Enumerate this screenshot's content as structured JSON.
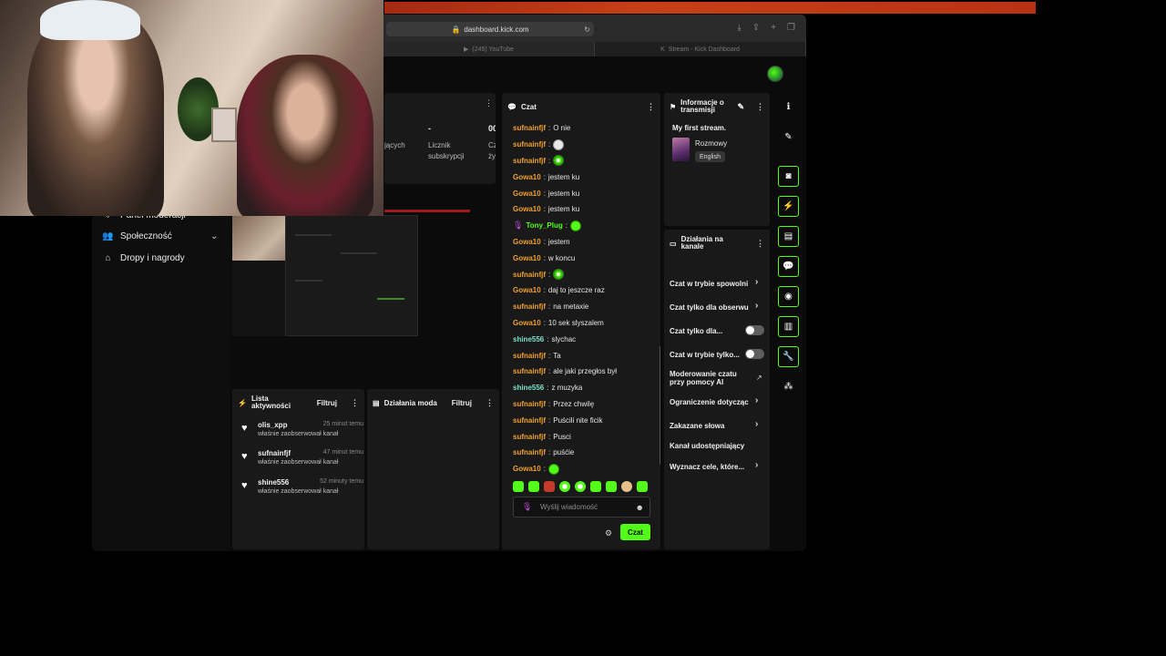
{
  "browser": {
    "url": "dashboard.kick.com",
    "tabs": [
      {
        "label": "(245) YouTube"
      },
      {
        "label": "Stream - Kick Dashboard"
      }
    ]
  },
  "sidebar": {
    "items": [
      {
        "label": "Panel moderacji",
        "icon": "shield-icon"
      },
      {
        "label": "Społeczność",
        "icon": "users-icon"
      },
      {
        "label": "Dropy i nagrody",
        "icon": "gift-icon"
      }
    ]
  },
  "stats": {
    "subs_value": "-",
    "subs_label_line1": "Licznik",
    "subs_label_line2": "subskrypcji",
    "time_value": "00:",
    "time_label_line1": "Cza",
    "time_label_line2": "żyw",
    "left_label": "jących"
  },
  "activity": {
    "title_line1": "Lista",
    "title_line2": "aktywności",
    "filter_label": "Filtruj",
    "items": [
      {
        "name": "olis_xpp",
        "time": "25 minut temu",
        "desc": "właśnie zaobserwował kanał"
      },
      {
        "name": "sufnainfjf",
        "time": "47 minut temu",
        "desc": "właśnie zaobserwował kanał"
      },
      {
        "name": "shine556",
        "time": "52 minuty temu",
        "desc": "właśnie zaobserwował kanał"
      }
    ]
  },
  "mod_actions": {
    "title": "Działania moda",
    "filter_label": "Filtruj"
  },
  "chat": {
    "title": "Czat",
    "messages": [
      {
        "user": "sufnainfjf",
        "color": "#f0a030",
        "text": "O nie"
      },
      {
        "user": "sufnainfjf",
        "color": "#f0a030",
        "text": "",
        "emote": "skull"
      },
      {
        "user": "sufnainfjf",
        "color": "#f0a030",
        "text": "",
        "emote": "gear"
      },
      {
        "user": "Gowa10",
        "color": "#f0a030",
        "text": "jestem ku"
      },
      {
        "user": "Gowa10",
        "color": "#f0a030",
        "text": "jestem ku"
      },
      {
        "user": "Gowa10",
        "color": "#f0a030",
        "text": "jestem ku"
      },
      {
        "user": "Tony_Plug",
        "color": "#53fc18",
        "text": "",
        "emote": "green",
        "mic": true
      },
      {
        "user": "Gowa10",
        "color": "#f0a030",
        "text": "jestem"
      },
      {
        "user": "Gowa10",
        "color": "#f0a030",
        "text": "w koncu"
      },
      {
        "user": "sufnainfjf",
        "color": "#f0a030",
        "text": "",
        "emote": "gear"
      },
      {
        "user": "Gowa10",
        "color": "#f0a030",
        "text": "daj to jeszcze raz"
      },
      {
        "user": "sufnainfjf",
        "color": "#f0a030",
        "text": "na metaxie"
      },
      {
        "user": "Gowa10",
        "color": "#f0a030",
        "text": "10 sek slyszalem"
      },
      {
        "user": "shine556",
        "color": "#7ee0c8",
        "text": "slychac"
      },
      {
        "user": "sufnainfjf",
        "color": "#f0a030",
        "text": "Ta"
      },
      {
        "user": "sufnainfjf",
        "color": "#f0a030",
        "text": "ale jaki przegłos był"
      },
      {
        "user": "shine556",
        "color": "#7ee0c8",
        "text": "z muzyka"
      },
      {
        "user": "sufnainfjf",
        "color": "#f0a030",
        "text": "Przez chwilę"
      },
      {
        "user": "sufnainfjf",
        "color": "#f0a030",
        "text": "Puścili nite ficik"
      },
      {
        "user": "sufnainfjf",
        "color": "#f0a030",
        "text": "Pusci"
      },
      {
        "user": "sufnainfjf",
        "color": "#f0a030",
        "text": "puśćie"
      },
      {
        "user": "Gowa10",
        "color": "#f0a030",
        "text": "",
        "emote": "green"
      }
    ],
    "input_placeholder": "Wyślij wiadomość",
    "send_label": "Czat"
  },
  "stream_info": {
    "title_line1": "Informacje o",
    "title_line2": "transmisji",
    "stream_title": "My first stream.",
    "category": "Rozmowy",
    "language": "English"
  },
  "channel_actions": {
    "title_line1": "Działania na",
    "title_line2": "kanale",
    "items": [
      {
        "label": "Czat w trybie spowolni",
        "control": "arrow"
      },
      {
        "label": "Czat tylko dla obserwu",
        "control": "arrow"
      },
      {
        "label": "Czat tylko dla...",
        "control": "toggle"
      },
      {
        "label": "Czat w trybie tylko...",
        "control": "toggle"
      },
      {
        "label_line1": "Moderowanie czatu",
        "label_line2": "przy pomocy AI",
        "control": "external"
      },
      {
        "label": "Ograniczenie dotycząc",
        "control": "arrow"
      },
      {
        "label": "Zakazane słowa",
        "control": "arrow"
      },
      {
        "label": "Kanał udostępniający",
        "control": "none"
      },
      {
        "label": "Wyznacz cele, które...",
        "control": "arrow"
      }
    ]
  },
  "colors": {
    "accent": "#53fc18",
    "panel": "#191919",
    "background": "#0b0b0b"
  }
}
